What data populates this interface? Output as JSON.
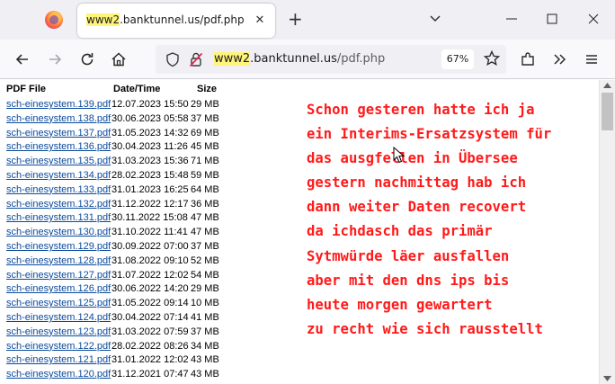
{
  "browser": {
    "tab": {
      "title": "www2.banktunnel.us/pdf.php",
      "close": "✕"
    },
    "new_tab": "+",
    "url": {
      "host_highlight": "www2",
      "host_rest": ".banktunnel.us",
      "path": "/pdf.php"
    },
    "zoom": "67%"
  },
  "table": {
    "headers": {
      "file": "PDF File",
      "date": "Date/Time",
      "size": "Size"
    },
    "rows": [
      {
        "file": "sch-einesystem.139.pdf",
        "date": "12.07.2023 15:50",
        "size": "29 MB"
      },
      {
        "file": "sch-einesystem.138.pdf",
        "date": "30.06.2023 05:58",
        "size": "37 MB"
      },
      {
        "file": "sch-einesystem.137.pdf",
        "date": "31.05.2023 14:32",
        "size": "69 MB"
      },
      {
        "file": "sch-einesystem.136.pdf",
        "date": "30.04.2023 11:26",
        "size": "45 MB"
      },
      {
        "file": "sch-einesystem.135.pdf",
        "date": "31.03.2023 15:36",
        "size": "71 MB"
      },
      {
        "file": "sch-einesystem.134.pdf",
        "date": "28.02.2023 15:48",
        "size": "59 MB"
      },
      {
        "file": "sch-einesystem.133.pdf",
        "date": "31.01.2023 16:25",
        "size": "64 MB"
      },
      {
        "file": "sch-einesystem.132.pdf",
        "date": "31.12.2022 12:17",
        "size": "36 MB"
      },
      {
        "file": "sch-einesystem.131.pdf",
        "date": "30.11.2022 15:08",
        "size": "47 MB"
      },
      {
        "file": "sch-einesystem.130.pdf",
        "date": "31.10.2022 11:41",
        "size": "47 MB"
      },
      {
        "file": "sch-einesystem.129.pdf",
        "date": "30.09.2022 07:00",
        "size": "37 MB"
      },
      {
        "file": "sch-einesystem.128.pdf",
        "date": "31.08.2022 09:10",
        "size": "52 MB"
      },
      {
        "file": "sch-einesystem.127.pdf",
        "date": "31.07.2022 12:02",
        "size": "54 MB"
      },
      {
        "file": "sch-einesystem.126.pdf",
        "date": "30.06.2022 14:20",
        "size": "29 MB"
      },
      {
        "file": "sch-einesystem.125.pdf",
        "date": "31.05.2022 09:14",
        "size": "10 MB"
      },
      {
        "file": "sch-einesystem.124.pdf",
        "date": "30.04.2022 07:14",
        "size": "41 MB"
      },
      {
        "file": "sch-einesystem.123.pdf",
        "date": "31.03.2022 07:59",
        "size": "37 MB"
      },
      {
        "file": "sch-einesystem.122.pdf",
        "date": "28.02.2022 08:26",
        "size": "34 MB"
      },
      {
        "file": "sch-einesystem.121.pdf",
        "date": "31.01.2022 12:02",
        "size": "43 MB"
      },
      {
        "file": "sch-einesystem.120.pdf",
        "date": "31.12.2021 07:47",
        "size": "43 MB"
      }
    ]
  },
  "note": {
    "lines": [
      "Schon gesteren hatte ich ja",
      "ein Interims-Ersatzsystem für",
      "das ausgfellen in Übersee",
      "gestern nachmittag hab ich",
      "dann weiter Daten recovert",
      "da ichdasch das primär",
      "Sytmwürde läer ausfallen",
      "aber mit den dns ips bis",
      "heute morgen gewartert",
      "zu recht wie sich rausstellt"
    ],
    "color": "#ff1a1a"
  },
  "colors": {
    "link": "#0b4a9c",
    "tabstrip": "#f0f0f4",
    "url_highlight": "#fff47a"
  }
}
